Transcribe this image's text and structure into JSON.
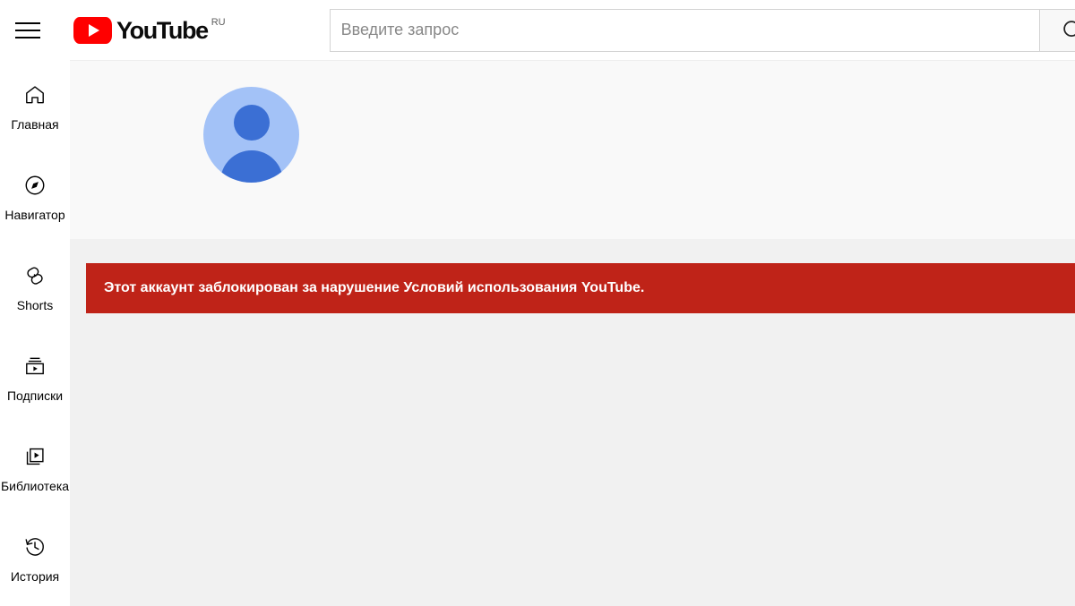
{
  "header": {
    "menu_icon": "hamburger-icon",
    "logo_text": "YouTube",
    "logo_country": "RU",
    "search": {
      "placeholder": "Введите запрос",
      "value": "",
      "button_icon": "search-icon"
    }
  },
  "sidebar": {
    "items": [
      {
        "label": "Главная",
        "icon": "home-icon"
      },
      {
        "label": "Навигатор",
        "icon": "compass-icon"
      },
      {
        "label": "Shorts",
        "icon": "shorts-icon"
      },
      {
        "label": "Подписки",
        "icon": "subscriptions-icon"
      },
      {
        "label": "Библиотека",
        "icon": "library-icon"
      },
      {
        "label": "История",
        "icon": "history-icon"
      }
    ]
  },
  "main": {
    "avatar_alt": "default-user-avatar",
    "alert": {
      "message": "Этот аккаунт заблокирован за нарушение Условий использования YouTube.",
      "background_color": "#bf2318",
      "text_color": "#ffffff"
    },
    "background_color": "#f1f1f1",
    "banner_background_color": "#f9f9f9"
  },
  "colors": {
    "brand_red": "#ff0000",
    "alert_red": "#bf2318",
    "avatar_light": "#a3c2f7",
    "avatar_dark": "#3b6fd4",
    "text_primary": "#030303",
    "text_muted": "#606060"
  }
}
